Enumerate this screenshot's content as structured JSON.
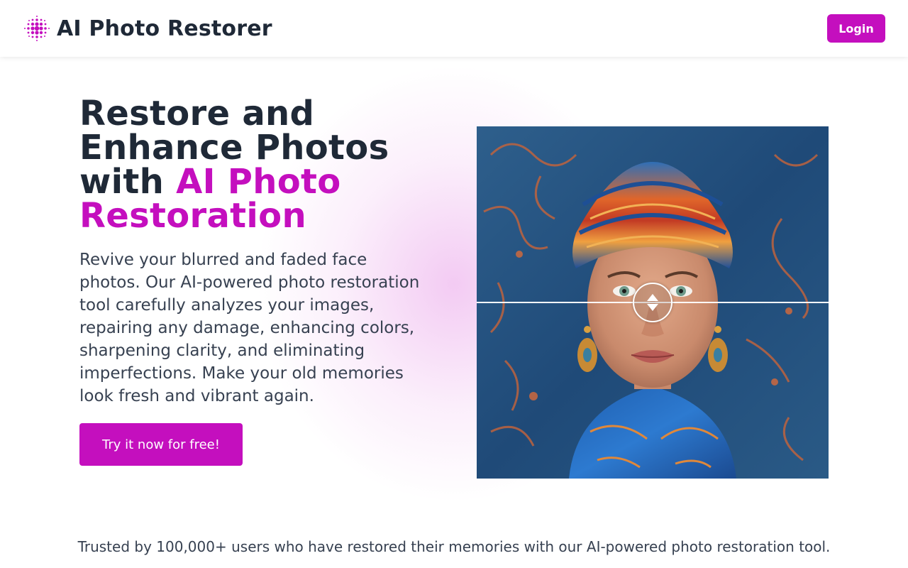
{
  "header": {
    "brand_title": "AI Photo Restorer",
    "logo_icon": "dot-grid-logo-icon",
    "login_label": "Login"
  },
  "hero": {
    "headline_part1": "Restore and Enhance Photos with ",
    "headline_accent": "AI Photo Restoration",
    "description": "Revive your blurred and faded face photos. Our AI-powered photo restoration tool carefully analyzes your images, repairing any damage, enhancing colors, sharpening clarity, and eliminating imperfections. Make your old memories look fresh and vibrant again.",
    "cta_label": "Try it now for free!"
  },
  "comparison": {
    "image_subject": "woman-with-colorful-headwrap",
    "handle_icon": "up-down-arrows-icon"
  },
  "footer_note": {
    "prefix": "Trusted by ",
    "count": "100,000+",
    "suffix": " users who have restored their memories with our AI-powered photo restoration tool."
  },
  "colors": {
    "accent": "#c40fbe",
    "heading": "#1f2937",
    "body_text": "#374151"
  }
}
